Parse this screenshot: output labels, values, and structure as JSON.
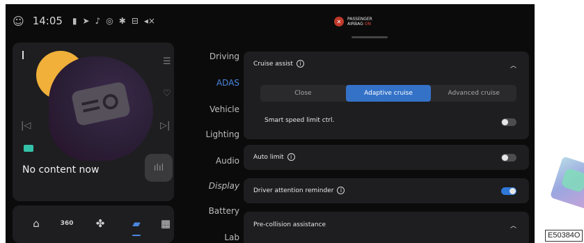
{
  "status_bar": {
    "time": "14:05",
    "icons": [
      "avatar-icon",
      "signal-icon",
      "navigation-icon",
      "mic-icon",
      "hotspot-icon",
      "bluetooth-icon",
      "lock-icon",
      "mute-icon"
    ],
    "airbag": {
      "line1": "PASSENGER",
      "line2": "AIRBAG",
      "state": "ON",
      "color": "#c0392b"
    }
  },
  "media": {
    "empty_text": "No content now",
    "colors": {
      "moon": "#f0b03a",
      "source_badge": "#33c2a8"
    }
  },
  "dock": {
    "items": [
      {
        "name": "home-icon",
        "label": "⌂"
      },
      {
        "name": "camera-360-icon",
        "label": "360"
      },
      {
        "name": "fan-icon",
        "label": "✤"
      },
      {
        "name": "car-icon",
        "label": "▰",
        "active": true
      },
      {
        "name": "apps-icon",
        "label": "▦"
      }
    ],
    "accent": "#4a86e0"
  },
  "menu": {
    "items": [
      "Driving",
      "ADAS",
      "Vehicle",
      "Lighting",
      "Audio",
      "Display",
      "Battery",
      "Lab"
    ],
    "active": "ADAS"
  },
  "settings": {
    "cruise_assist": {
      "label": "Cruise assist",
      "expanded": true,
      "options": [
        "Close",
        "Adaptive cruise",
        "Advanced cruise"
      ],
      "selected": "Adaptive cruise",
      "smart_speed_label": "Smart speed limit ctrl.",
      "smart_speed_on": false
    },
    "auto_limit": {
      "label": "Auto limit",
      "on": false
    },
    "driver_attention": {
      "label": "Driver attention reminder",
      "on": true
    },
    "pre_collision": {
      "label": "Pre-collision assistance",
      "expanded": true
    }
  },
  "watermark": "E50384O"
}
